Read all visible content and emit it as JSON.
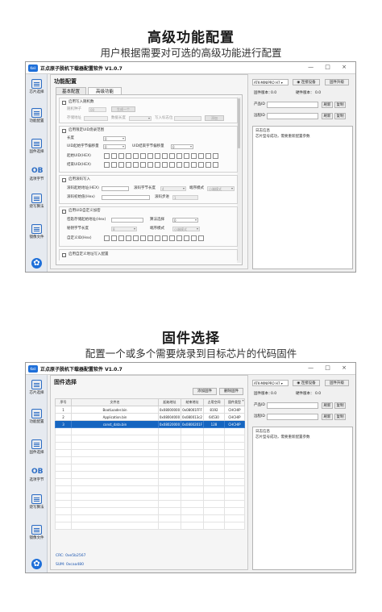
{
  "section1": {
    "heading": "高级功能配置",
    "subheading": "用户根据需要对可选的高级功能进行配置"
  },
  "section2": {
    "heading": "固件选择",
    "subheading": "配置一个或多个需要烧录到目标芯片的代码固件"
  },
  "window": {
    "title": "正点原子脱机下载器配置软件 V1.0.7",
    "app_icon_text": "Keil",
    "controls": "— □ ×"
  },
  "sidebar": {
    "items": [
      {
        "label": "芯片选择",
        "icon": "chip-icon"
      },
      {
        "label": "功能配置",
        "icon": "config-icon"
      },
      {
        "label": "固件选择",
        "icon": "firmware-icon"
      },
      {
        "label": "选项字节",
        "icon": "option-bytes-icon",
        "glyph": "OB"
      },
      {
        "label": "烧写算法",
        "icon": "algorithm-icon"
      },
      {
        "label": "镜像文件",
        "icon": "image-file-icon"
      }
    ],
    "settings_glyph": "✿"
  },
  "right": {
    "device_select": "ATK-MINIPRO H7 ▾",
    "connect_label": "◉ 连接设备",
    "upgrade_label": "固件升级",
    "fw_version_label": "固件版本：",
    "fw_version_value": "0.0",
    "hw_version_label": "硬件版本：",
    "hw_version_value": "0.0",
    "product_id_label": "产品ID",
    "remote_id_label": "远程ID",
    "refresh_label": "刷新",
    "copy_label": "复制",
    "log_label": "日志信息",
    "log_text": "芯片型号成功，需要重新配置参数"
  },
  "adv": {
    "panel_title": "功能配置",
    "tab_basic": "基本配置",
    "tab_advanced": "高级功能",
    "random_enable": "启用写入随机数",
    "random_seed_label": "随机种子",
    "random_seed_value": "00",
    "random_btn": "生成一个",
    "random_addr_label": "存储地址",
    "random_len_label": "数据长度",
    "random_flag_label": "写入标志位",
    "random_add_btn": "添加",
    "uid_enable": "启用限定UID烧录范围",
    "uid_length_label": "长度",
    "uid_length_value": "0",
    "uid_start_offset_label": "UID起始字节偏移量",
    "uid_end_offset_label": "UID结束字节偏移量",
    "uid_start_offset_value": "0",
    "uid_end_offset_value": "0",
    "uid_start_label": "起始UID(HEX)",
    "uid_end_label": "结束UID(HEX)",
    "rolling_enable": "启用滚码写入",
    "rolling_addr_label": "滚码起始地址(HEX)",
    "rolling_bytes_label": "滚码字节长度",
    "rolling_bytes_value": "4",
    "rolling_mode_label": "端序模式",
    "rolling_mode_value": "小端模式",
    "rolling_init_label": "滚码初始值(Hex)",
    "rolling_step_label": "滚码步进",
    "rolling_step_value": "1",
    "uid_custom_enable": "启用UID自定义加密",
    "uid_store_addr_label": "密匙存储起始地址(Hex)",
    "uid_algo_label": "算法选择",
    "uid_algo_value": "0",
    "uid_keylen_label": "秘钥字节长度",
    "uid_keylen_value": "8",
    "uid_mode_label": "端序模式",
    "uid_mode_value": "小端模式",
    "uid_custom_text_label": "自定义ID(Hex)",
    "more_enable": "启用自定义地址写入配置"
  },
  "fw": {
    "panel_title": "固件选择",
    "add_label": "添加固件",
    "remove_label": "删除固件",
    "columns": [
      "序号",
      "文件名",
      "起始地址",
      "结束地址",
      "占用空间",
      "固件类型"
    ],
    "rows": [
      [
        "1",
        "BootLoader.bin",
        "0x08000000",
        "0x08001FFF",
        "8192",
        "CHCHIP"
      ],
      [
        "2",
        "Application.bin",
        "0x08004000",
        "0x080013c2",
        "64530",
        "CHCHIP"
      ],
      [
        "3",
        "const_data.bin",
        "0x08020000",
        "0x0800201F",
        "128",
        "CHCHIP"
      ]
    ],
    "empty_rows": 14,
    "crc": "CRC: 0xe5b2567",
    "sum": "SUM: 0xcaa480"
  }
}
